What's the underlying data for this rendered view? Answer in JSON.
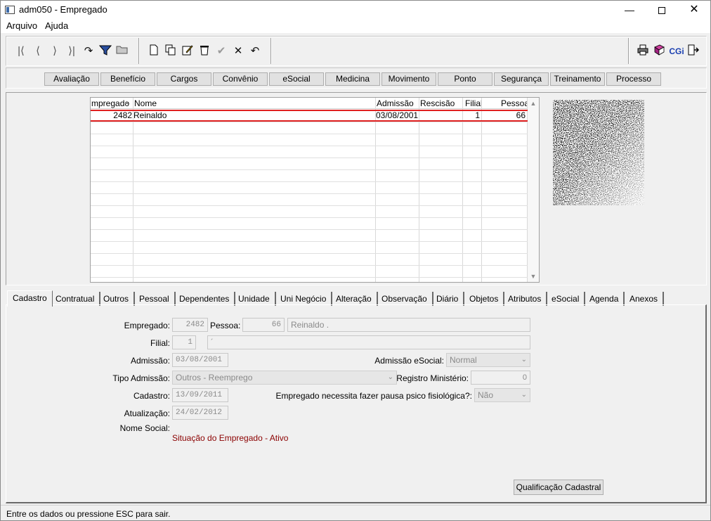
{
  "window": {
    "title": "adm050 - Empregado"
  },
  "menu": {
    "items": [
      "Arquivo",
      "Ajuda"
    ]
  },
  "toolbar": {
    "nav_icons": [
      "first-record-icon",
      "prev-record-icon",
      "next-record-icon",
      "last-record-icon",
      "refresh-icon",
      "filter-icon",
      "folder-open-icon"
    ],
    "edit_icons": [
      "new-document-icon",
      "copy-icon",
      "edit-icon",
      "delete-icon",
      "confirm-icon",
      "cancel-icon",
      "undo-icon"
    ],
    "right_icons": [
      "print-icon",
      "book-icon",
      "cgi-icon",
      "exit-icon"
    ],
    "cgi_label": "CGi"
  },
  "modules": [
    "Avaliação",
    "Benefício",
    "Cargos",
    "Convênio",
    "eSocial",
    "Medicina",
    "Movimento",
    "Ponto",
    "Segurança",
    "Treinamento",
    "Processo"
  ],
  "grid": {
    "columns": [
      "mpregado",
      "Nome",
      "Admissão",
      "Rescisão",
      "Filial",
      "Pessoa"
    ],
    "rows": [
      {
        "empregado": "2482",
        "nome": "Reinaldo",
        "admissao": "03/08/2001",
        "rescisao": "",
        "filial": "1",
        "pessoa": "66"
      }
    ]
  },
  "tabs": [
    "Cadastro",
    "Contratual",
    "Outros",
    "Pessoal",
    "Dependentes",
    "Unidade",
    "Uni Negócio",
    "Alteração",
    "Observação",
    "Diário",
    "Objetos",
    "Atributos",
    "eSocial",
    "Agenda",
    "Anexos"
  ],
  "form": {
    "empregado_label": "Empregado:",
    "empregado_value": "2482",
    "pessoa_label": "Pessoa:",
    "pessoa_value": "66",
    "nome_value": "Reinaldo .",
    "filial_label": "Filial:",
    "filial_value": "1",
    "filial_desc": "´",
    "admissao_label": "Admissão:",
    "admissao_value": "03/08/2001",
    "admissao_esocial_label": "Admissão eSocial:",
    "admissao_esocial_value": "Normal",
    "tipo_admissao_label": "Tipo Admissão:",
    "tipo_admissao_value": "Outros - Reemprego",
    "registro_label": "Registro Ministério:",
    "registro_value": "0",
    "cadastro_label": "Cadastro:",
    "cadastro_value": "13/09/2011",
    "pausa_label": "Empregado necessita fazer pausa psico fisiológica?:",
    "pausa_value": "Não",
    "atualizacao_label": "Atualização:",
    "atualizacao_value": "24/02/2012",
    "nome_social_label": "Nome Social:",
    "situacao": "Situação do Empregado - Ativo",
    "qualificacao_button": "Qualificação Cadastral"
  },
  "status": {
    "text": "Entre os dados ou pressione ESC para sair."
  }
}
